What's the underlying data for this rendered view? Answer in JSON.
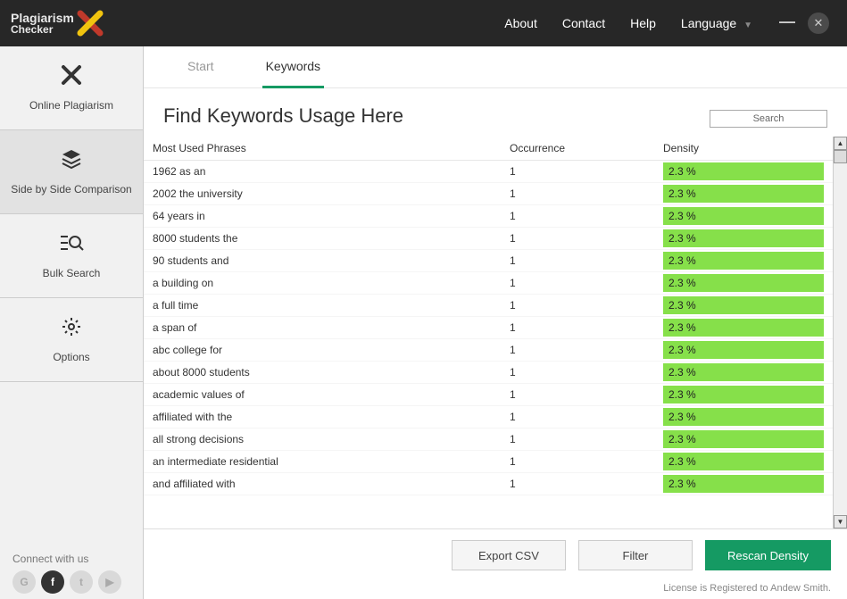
{
  "logo": {
    "line1": "Plagiarism",
    "line2": "Checker"
  },
  "topMenu": {
    "about": "About",
    "contact": "Contact",
    "help": "Help",
    "language": "Language"
  },
  "sidebar": {
    "items": [
      {
        "label": "Online Plagiarism"
      },
      {
        "label": "Side by Side Comparison"
      },
      {
        "label": "Bulk Search"
      },
      {
        "label": "Options"
      }
    ],
    "connectLabel": "Connect with us"
  },
  "tabs": {
    "start": "Start",
    "keywords": "Keywords"
  },
  "pageTitle": "Find Keywords Usage Here",
  "searchPlaceholder": "Search",
  "tableHeader": {
    "phrase": "Most Used Phrases",
    "occurrence": "Occurrence",
    "density": "Density"
  },
  "rows": [
    {
      "phrase": "1962 as an",
      "occurrence": "1",
      "density": "2.3 %"
    },
    {
      "phrase": "2002 the university",
      "occurrence": "1",
      "density": "2.3 %"
    },
    {
      "phrase": "64 years in",
      "occurrence": "1",
      "density": "2.3 %"
    },
    {
      "phrase": "8000 students the",
      "occurrence": "1",
      "density": "2.3 %"
    },
    {
      "phrase": "90 students and",
      "occurrence": "1",
      "density": "2.3 %"
    },
    {
      "phrase": "a building on",
      "occurrence": "1",
      "density": "2.3 %"
    },
    {
      "phrase": "a full time",
      "occurrence": "1",
      "density": "2.3 %"
    },
    {
      "phrase": "a span of",
      "occurrence": "1",
      "density": "2.3 %"
    },
    {
      "phrase": "abc college for",
      "occurrence": "1",
      "density": "2.3 %"
    },
    {
      "phrase": "about 8000 students",
      "occurrence": "1",
      "density": "2.3 %"
    },
    {
      "phrase": "academic values of",
      "occurrence": "1",
      "density": "2.3 %"
    },
    {
      "phrase": "affiliated with the",
      "occurrence": "1",
      "density": "2.3 %"
    },
    {
      "phrase": "all strong decisions",
      "occurrence": "1",
      "density": "2.3 %"
    },
    {
      "phrase": "an intermediate residential",
      "occurrence": "1",
      "density": "2.3 %"
    },
    {
      "phrase": "and affiliated with",
      "occurrence": "1",
      "density": "2.3 %"
    }
  ],
  "footer": {
    "exportCsv": "Export CSV",
    "filter": "Filter",
    "rescan": "Rescan Density"
  },
  "licenseLine": "License is Registered to Andew Smith."
}
